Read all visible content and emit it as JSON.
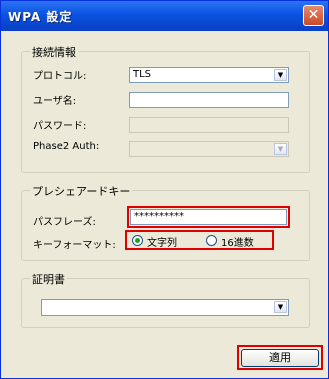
{
  "window": {
    "title": "WPA 設定",
    "close_glyph": "✕"
  },
  "connection": {
    "legend": "接続情報",
    "protocol_label": "プロトコル:",
    "protocol_value": "TLS",
    "username_label": "ユーザ名:",
    "username_value": "",
    "password_label": "パスワード:",
    "password_value": "",
    "phase2_label": "Phase2 Auth:",
    "phase2_value": ""
  },
  "psk": {
    "legend": "プレシェアードキー",
    "passphrase_label": "パスフレーズ:",
    "passphrase_value": "**********",
    "keyformat_label": "キーフォーマット:",
    "option_text": "文字列",
    "option_hex": "16進数",
    "selected": "文字列"
  },
  "certificate": {
    "legend": "証明書",
    "value": ""
  },
  "apply_button": "適用",
  "colors": {
    "highlight": "#e00000",
    "title_bar": "#0a53e0",
    "background": "#ece9d8"
  }
}
